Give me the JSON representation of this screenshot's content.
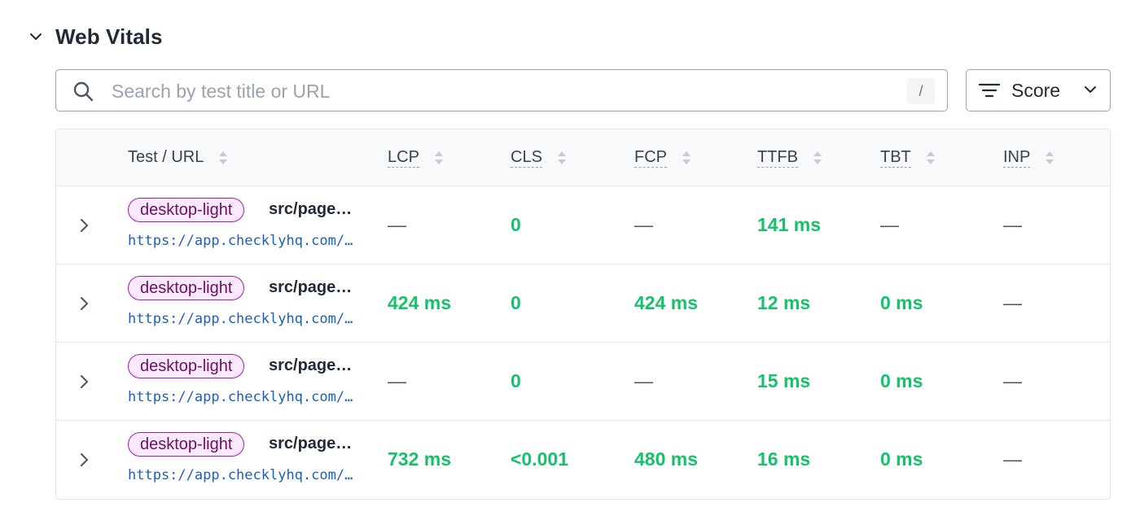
{
  "section": {
    "title": "Web Vitals"
  },
  "search": {
    "placeholder": "Search by test title or URL",
    "value": "",
    "shortcut": "/"
  },
  "filter": {
    "label": "Score"
  },
  "table": {
    "columns": [
      "Test / URL",
      "LCP",
      "CLS",
      "FCP",
      "TTFB",
      "TBT",
      "INP"
    ],
    "rows": [
      {
        "tag": "desktop-light",
        "title": "src/pages/...",
        "url": "https://app.checklyhq.com/...",
        "lcp": "—",
        "cls": "0",
        "fcp": "—",
        "ttfb": "141 ms",
        "tbt": "—",
        "inp": "—"
      },
      {
        "tag": "desktop-light",
        "title": "src/pages/...",
        "url": "https://app.checklyhq.com/...",
        "lcp": "424 ms",
        "cls": "0",
        "fcp": "424 ms",
        "ttfb": "12 ms",
        "tbt": "0 ms",
        "inp": "—"
      },
      {
        "tag": "desktop-light",
        "title": "src/pages/...",
        "url": "https://app.checklyhq.com/...",
        "lcp": "—",
        "cls": "0",
        "fcp": "—",
        "ttfb": "15 ms",
        "tbt": "0 ms",
        "inp": "—"
      },
      {
        "tag": "desktop-light",
        "title": "src/pages/...",
        "url": "https://app.checklyhq.com/...",
        "lcp": "732 ms",
        "cls": "<0.001",
        "fcp": "480 ms",
        "ttfb": "16 ms",
        "tbt": "0 ms",
        "inp": "—"
      }
    ]
  },
  "colors": {
    "good": "#16c16a",
    "tag_border": "#a21caf",
    "tag_bg": "#fae8ff",
    "link": "#1d5fbf"
  }
}
